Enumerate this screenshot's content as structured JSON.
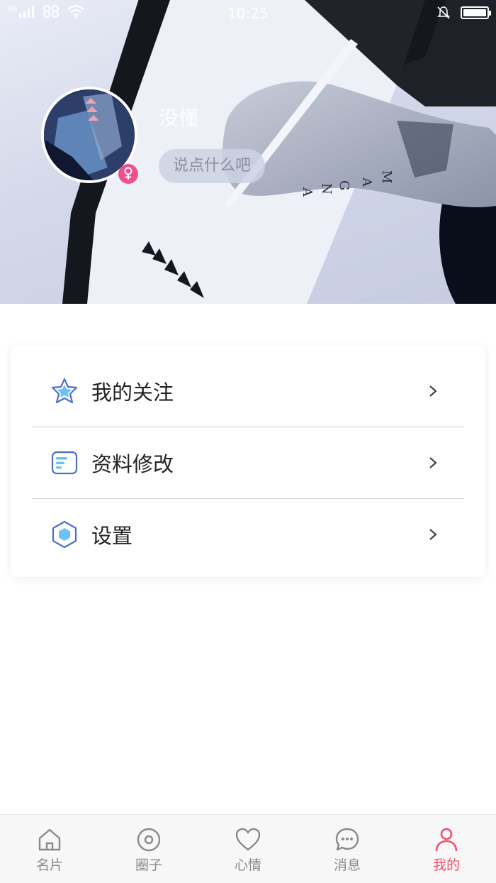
{
  "status_bar": {
    "network": "4G",
    "time": "10:25"
  },
  "profile": {
    "username": "没懂",
    "signature_placeholder": "说点什么吧",
    "gender_icon": "female-icon"
  },
  "menu": [
    {
      "label": "我的关注",
      "icon": "star-icon"
    },
    {
      "label": "资料修改",
      "icon": "profile-card-icon"
    },
    {
      "label": "设置",
      "icon": "hexagon-settings-icon"
    }
  ],
  "tabs": [
    {
      "label": "名片",
      "icon": "home-icon",
      "active": false
    },
    {
      "label": "圈子",
      "icon": "circle-icon",
      "active": false
    },
    {
      "label": "心情",
      "icon": "heart-icon",
      "active": false
    },
    {
      "label": "消息",
      "icon": "chat-icon",
      "active": false
    },
    {
      "label": "我的",
      "icon": "person-icon",
      "active": true
    }
  ],
  "colors": {
    "accent": "#f0506e",
    "icon_blue": "#4a6fd0",
    "icon_fill": "#6ec1f5",
    "tab_inactive": "#8a8a8a",
    "female_badge": "#ef4f8f"
  }
}
